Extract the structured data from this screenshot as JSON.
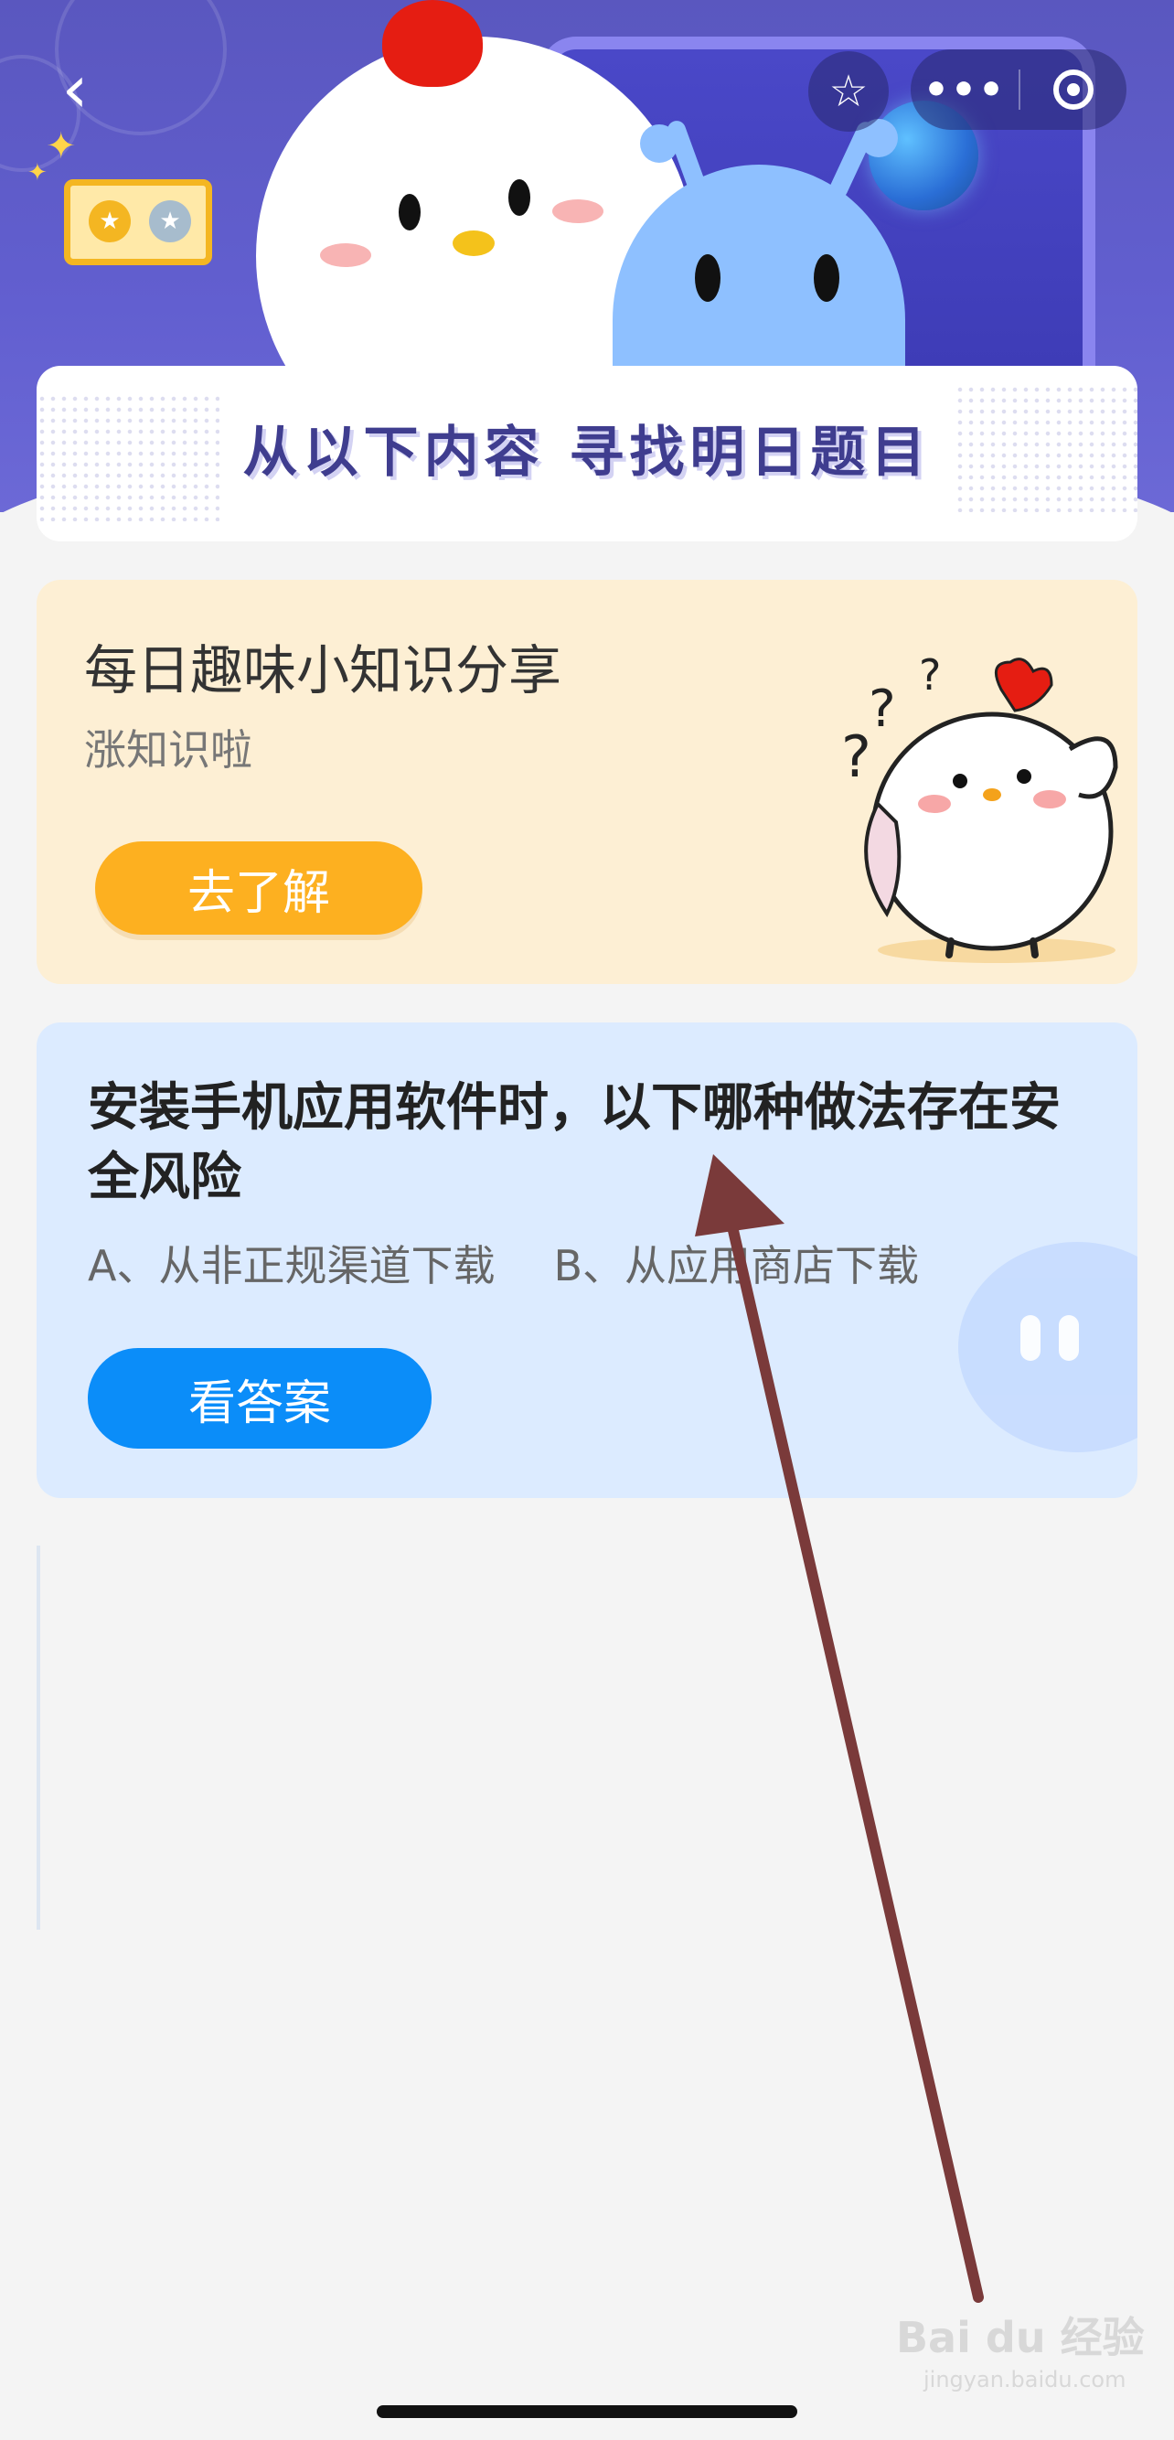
{
  "header": {
    "back_icon": "chevron-left-icon",
    "star_icon": "star-icon",
    "more_icon": "ellipsis-icon",
    "close_icon": "target-icon"
  },
  "banner": {
    "title": "从以下内容  寻找明日题目"
  },
  "knowledge_card": {
    "title": "每日趣味小知识分享",
    "subtitle": "涨知识啦",
    "button_label": "去了解"
  },
  "question_card": {
    "question": "安装手机应用软件时，以下哪种做法存在安全风险",
    "option_a": "A、从非正规渠道下载",
    "option_b": "B、从应用商店下载",
    "button_label": "看答案"
  },
  "watermark": {
    "brand": "Bai du 经验",
    "url": "jingyan.baidu.com"
  },
  "colors": {
    "hero_purple": "#5a57bf",
    "orange_button": "#fdb020",
    "blue_button": "#0b8df9",
    "annotation_arrow": "#7a3a3a"
  }
}
